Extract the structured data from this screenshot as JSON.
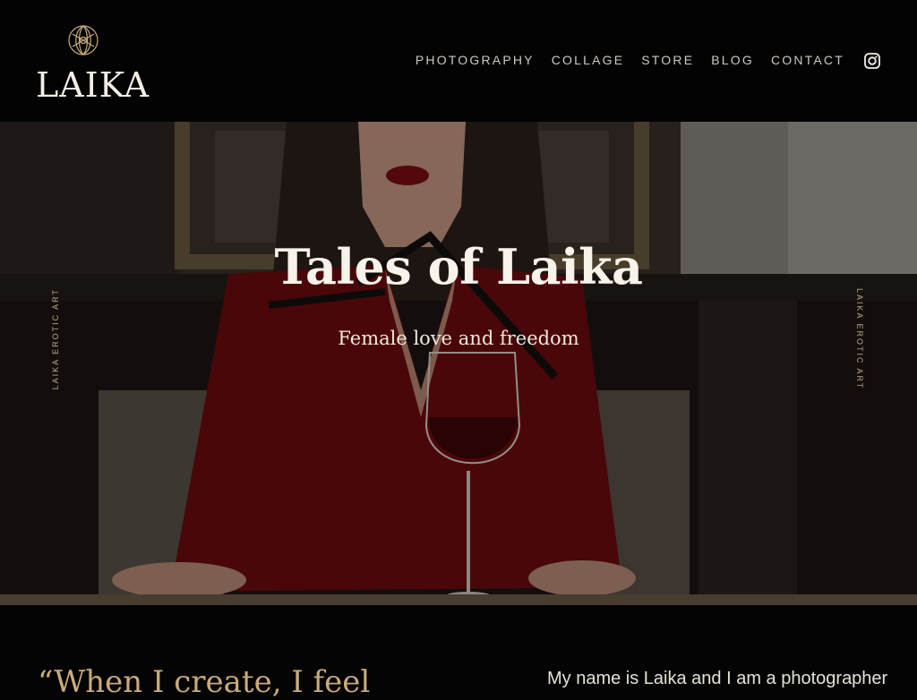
{
  "header": {
    "logo_text": "LAIKA",
    "nav": [
      "PHOTOGRAPHY",
      "COLLAGE",
      "STORE",
      "BLOG",
      "CONTACT"
    ],
    "instagram_icon": "instagram-icon"
  },
  "hero": {
    "title": "Tales of Laika",
    "subtitle": "Female love and freedom",
    "side_left": "LAIKA EROTIC ART",
    "side_right": "LAIKA EROTIC ART"
  },
  "intro": {
    "quote": "“When I create, I feel",
    "text": "My name is Laika and I am a photographer"
  },
  "colors": {
    "accent": "#c9ab7c",
    "header_bg": "#030303",
    "page_bg": "#040404"
  }
}
